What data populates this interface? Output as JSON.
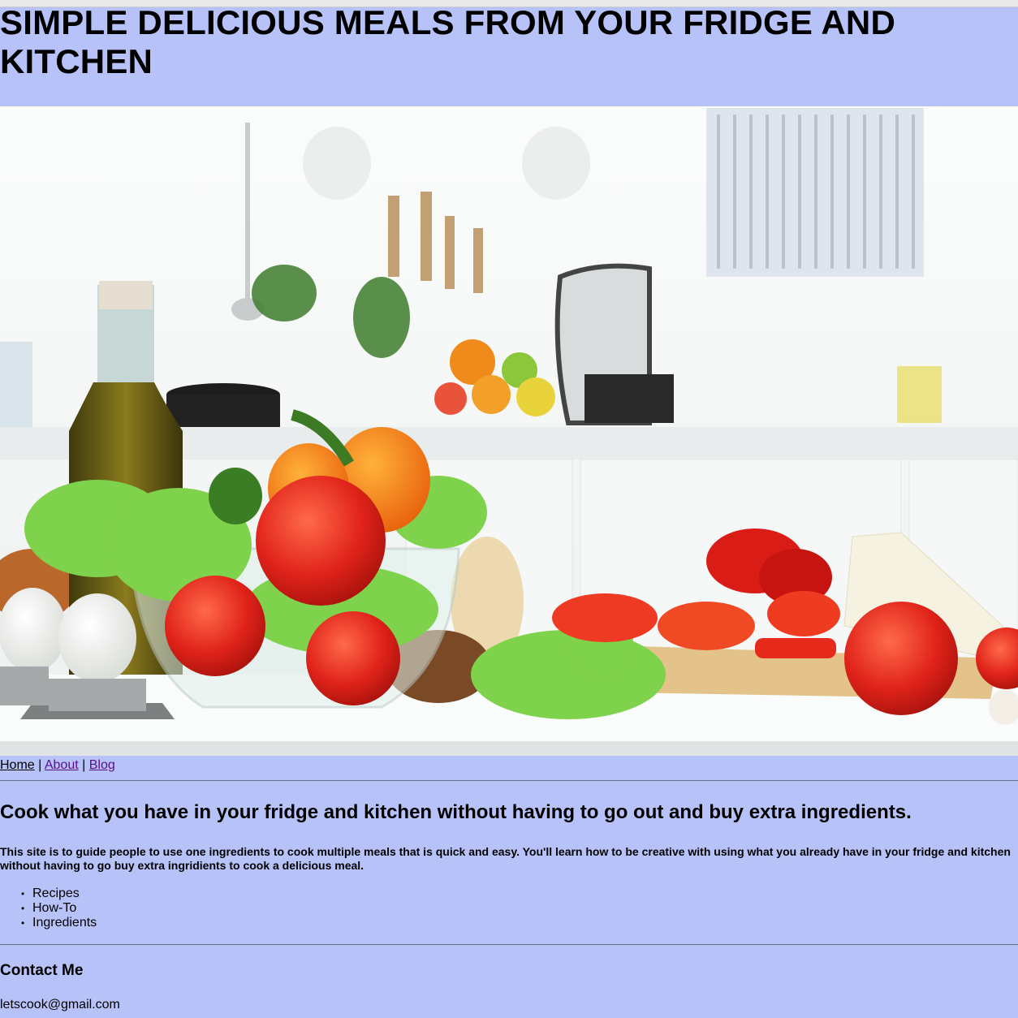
{
  "header": {
    "title": "SIMPLE DELICIOUS MEALS FROM YOUR FRIDGE AND KITCHEN"
  },
  "hero_image": {
    "subject": "kitchen counter with fresh vegetables, salad bowl, olive oil, eggs and cheese"
  },
  "nav": {
    "links": [
      {
        "label": "Home"
      },
      {
        "label": "About"
      },
      {
        "label": "Blog"
      }
    ],
    "separator": "|"
  },
  "main": {
    "headline": "Cook what you have in your fridge and kitchen without having to go out and buy extra ingredients.",
    "intro": "This site is to guide people to use one ingredients to cook multiple meals that is quick and easy. You'll learn how to be creative with using what you already have in your fridge and kitchen without having to go buy extra ingridients to cook a delicious meal.",
    "topics": [
      "Recipes",
      "How-To",
      "Ingredients"
    ]
  },
  "contact": {
    "title": "Contact Me",
    "email": "letscook@gmail.com"
  },
  "colors": {
    "page_background": "#b7c3f8",
    "visited_link": "#5b0f8a"
  }
}
